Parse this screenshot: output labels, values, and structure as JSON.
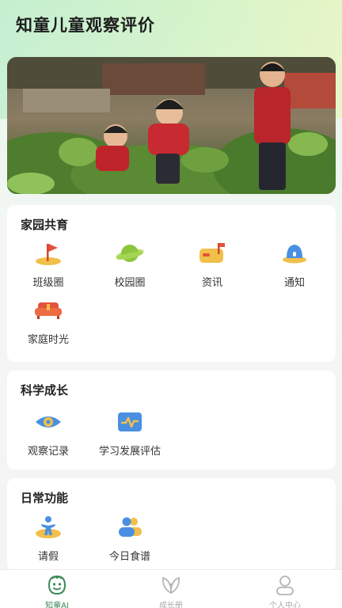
{
  "header": {
    "title": "知童儿童观察评价"
  },
  "banner": {
    "alt": ""
  },
  "sections": [
    {
      "title": "家园共育",
      "items": [
        {
          "label": "班级圈",
          "icon": "flag-icon"
        },
        {
          "label": "校园圈",
          "icon": "planet-icon"
        },
        {
          "label": "资讯",
          "icon": "mailbox-icon"
        },
        {
          "label": "通知",
          "icon": "bell-icon"
        },
        {
          "label": "家庭时光",
          "icon": "sofa-icon"
        }
      ]
    },
    {
      "title": "科学成长",
      "items": [
        {
          "label": "观察记录",
          "icon": "eye-icon"
        },
        {
          "label": "学习发展评估",
          "icon": "chart-monitor-icon"
        }
      ]
    },
    {
      "title": "日常功能",
      "items": [
        {
          "label": "请假",
          "icon": "person-leave-icon"
        },
        {
          "label": "今日食谱",
          "icon": "people-icon"
        }
      ]
    }
  ],
  "tabbar": {
    "tabs": [
      {
        "label": "知童AI",
        "icon": "smiley-face-icon",
        "active": true
      },
      {
        "label": "成长册",
        "icon": "leaf-icon",
        "active": false
      },
      {
        "label": "个人中心",
        "icon": "user-icon",
        "active": false
      }
    ]
  },
  "colors": {
    "accent": "#3d8a5a",
    "blue": "#4a8fe3",
    "orange": "#f1c04a",
    "red": "#e2533b",
    "green": "#8cc63f"
  }
}
